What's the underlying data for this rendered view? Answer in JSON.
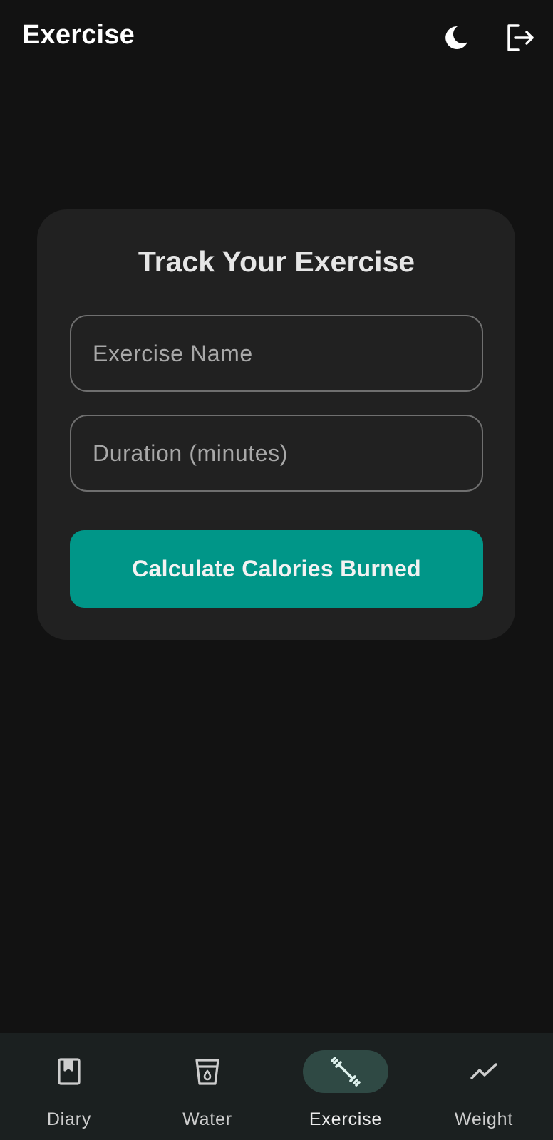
{
  "header": {
    "title": "Exercise",
    "theme_icon": "moon-icon",
    "logout_icon": "logout-icon"
  },
  "form": {
    "title": "Track Your Exercise",
    "exercise_name_placeholder": "Exercise Name",
    "exercise_name_value": "",
    "duration_placeholder": "Duration (minutes)",
    "duration_value": "",
    "submit_label": "Calculate Calories Burned"
  },
  "bottom_nav": {
    "items": [
      {
        "label": "Diary",
        "icon": "book-icon",
        "active": false
      },
      {
        "label": "Water",
        "icon": "water-cup-icon",
        "active": false
      },
      {
        "label": "Exercise",
        "icon": "dumbbell-icon",
        "active": true
      },
      {
        "label": "Weight",
        "icon": "trend-line-icon",
        "active": false
      }
    ]
  },
  "colors": {
    "background": "#121212",
    "card": "#212121",
    "accent": "#009688",
    "nav_background": "#1b2020",
    "active_pill": "#2f4944"
  }
}
